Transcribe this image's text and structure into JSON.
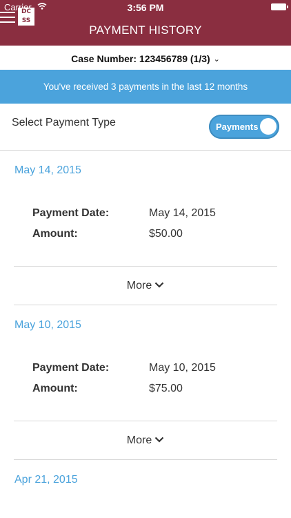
{
  "status_bar": {
    "carrier": "Carrier",
    "time": "3:56 PM"
  },
  "header": {
    "title": "PAYMENT HISTORY",
    "logo_top": "DC",
    "logo_bottom": "SS"
  },
  "case": {
    "label": "Case Number: 123456789 (1/3)"
  },
  "banner": {
    "text": "You've received 3 payments in the last 12 months"
  },
  "payment_type": {
    "label": "Select Payment Type",
    "toggle_label": "Payments",
    "toggle_on": true
  },
  "labels": {
    "payment_date": "Payment Date:",
    "amount": "Amount:",
    "more": "More"
  },
  "payments": [
    {
      "heading": "May 14, 2015",
      "payment_date": "May 14, 2015",
      "amount": "$50.00"
    },
    {
      "heading": "May 10, 2015",
      "payment_date": "May 10, 2015",
      "amount": "$75.00"
    },
    {
      "heading": "Apr 21, 2015"
    }
  ],
  "colors": {
    "header": "#8a2e40",
    "accent": "#4ba3dc"
  }
}
